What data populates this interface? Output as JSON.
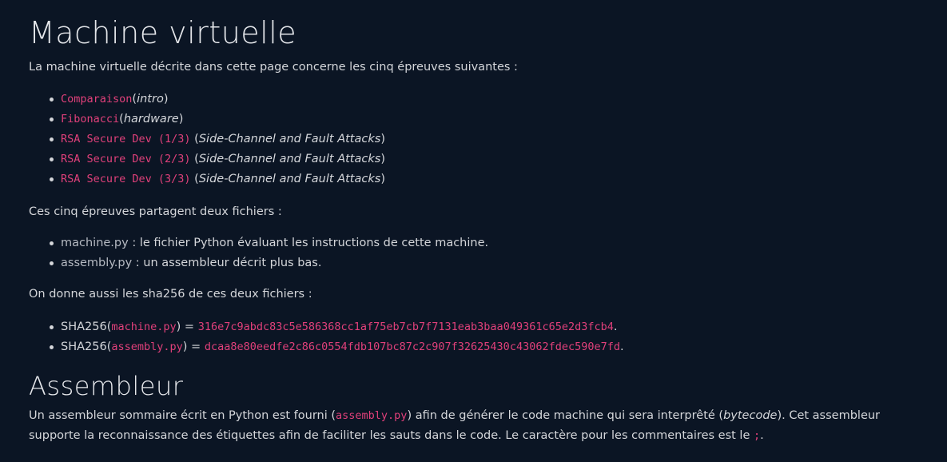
{
  "heading_vm": "Machine virtuelle",
  "intro": "La machine virtuelle décrite dans cette page concerne les cinq épreuves suivantes :",
  "challenges": [
    {
      "name": "Comparaison",
      "category": "intro"
    },
    {
      "name": "Fibonacci",
      "category": "hardware"
    },
    {
      "name": "RSA Secure Dev (1/3)",
      "category": "Side-Channel and Fault Attacks"
    },
    {
      "name": "RSA Secure Dev (2/3)",
      "category": "Side-Channel and Fault Attacks"
    },
    {
      "name": "RSA Secure Dev (3/3)",
      "category": "Side-Channel and Fault Attacks"
    }
  ],
  "paren_open": "(",
  "paren_close": ")",
  "files_intro": "Ces cinq épreuves partagent deux fichiers :",
  "files": [
    {
      "name": "machine.py",
      "desc": " : le fichier Python évaluant les instructions de cette machine."
    },
    {
      "name": "assembly.py",
      "desc": " : un assembleur décrit plus bas."
    }
  ],
  "sha_intro": "On donne aussi les sha256 de ces deux fichiers :",
  "hashes": [
    {
      "prefix": "SHA256(",
      "file": "machine.py",
      "mid": ") = ",
      "hash": "316e7c9abdc83c5e586368cc1af75eb7cb7f7131eab3baa049361c65e2d3fcb4",
      "suffix": "."
    },
    {
      "prefix": "SHA256(",
      "file": "assembly.py",
      "mid": ") = ",
      "hash": "dcaa8e80eedfe2c86c0554fdb107bc87c2c907f32625430c43062fdec590e7fd",
      "suffix": "."
    }
  ],
  "heading_asm": "Assembleur",
  "asm_text": {
    "part1": "Un assembleur sommaire écrit en Python est fourni (",
    "file": "assembly.py",
    "part2": ") afin de générer le code machine qui sera interprêté (",
    "term": "bytecode",
    "part3": "). Cet assembleur supporte la reconnaissance des étiquettes afin de faciliter les sauts dans le code. Le caractère pour les commentaires est le ",
    "comment_char": ";",
    "part4": "."
  }
}
